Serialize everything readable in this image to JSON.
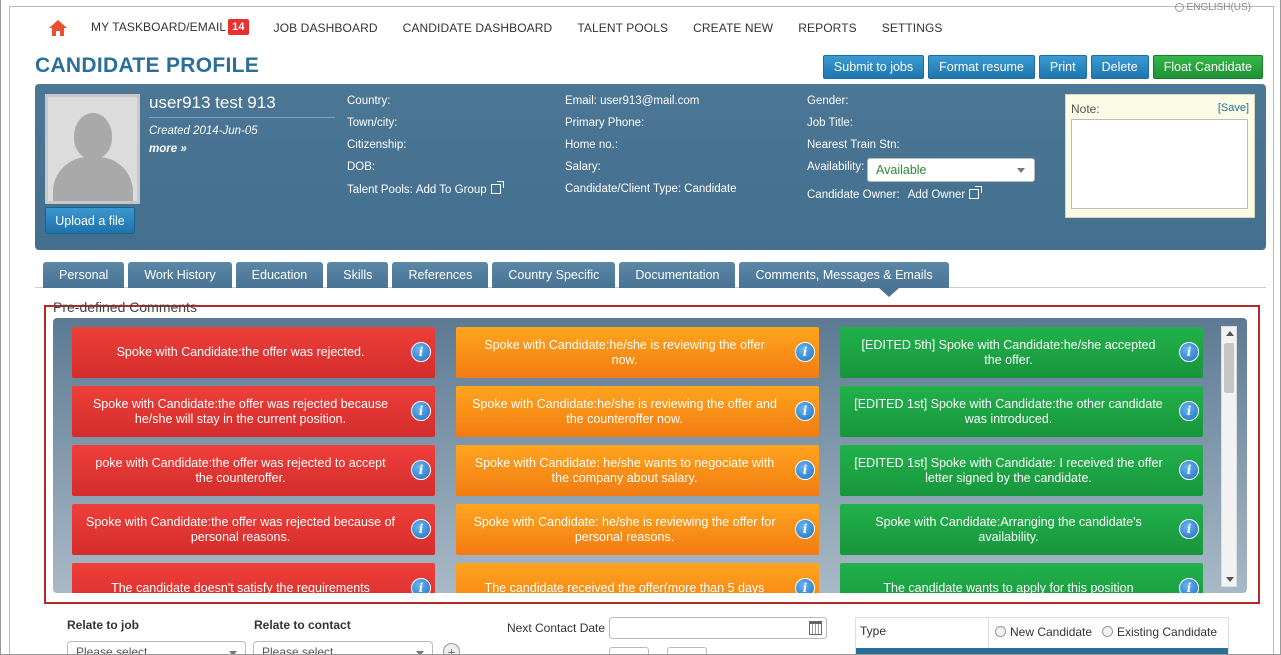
{
  "language": "ENGLISH(US)",
  "nav": {
    "items": [
      {
        "label": "MY TASKBOARD/EMAIL",
        "badge": "14"
      },
      {
        "label": "JOB DASHBOARD"
      },
      {
        "label": "CANDIDATE DASHBOARD"
      },
      {
        "label": "TALENT POOLS"
      },
      {
        "label": "CREATE NEW"
      },
      {
        "label": "REPORTS"
      },
      {
        "label": "SETTINGS"
      }
    ]
  },
  "header": {
    "title": "CANDIDATE PROFILE",
    "actions": [
      "Submit to jobs",
      "Format resume",
      "Print",
      "Delete",
      "Float Candidate"
    ]
  },
  "profile": {
    "name": "user913 test 913",
    "created": "Created 2014-Jun-05",
    "more": "more »",
    "upload": "Upload a file",
    "col1": {
      "country": "Country:",
      "town": "Town/city:",
      "citizenship": "Citizenship:",
      "dob": "DOB:",
      "talent_pools_label": "Talent Pools:",
      "talent_pools_link": "Add To Group"
    },
    "col2": {
      "email": "Email: user913@mail.com",
      "primary_phone": "Primary Phone:",
      "home_no": "Home no.:",
      "salary": "Salary:",
      "type_label": "Candidate/Client Type:",
      "type_value": "Candidate"
    },
    "col3": {
      "gender": "Gender:",
      "job_title": "Job Title:",
      "nearest_train": "Nearest Train Stn:",
      "availability_label": "Availability:",
      "availability_value": "Available",
      "owner_label": "Candidate Owner:",
      "owner_link": "Add Owner"
    },
    "note": {
      "label": "Note:",
      "save": "[Save]"
    }
  },
  "tabs": [
    "Personal",
    "Work History",
    "Education",
    "Skills",
    "References",
    "Country Specific",
    "Documentation",
    "Comments, Messages & Emails"
  ],
  "predefined": {
    "label": "Pre-defined Comments",
    "red": [
      "Spoke with Candidate:the offer was rejected.",
      "Spoke with Candidate:the offer was rejected because he/she will stay in the current position.",
      "poke with Candidate:the offer was rejected to accept the counteroffer.",
      "Spoke with Candidate:the offer was rejected because of personal reasons.",
      "The candidate doesn't satisfy the requirements"
    ],
    "orange": [
      "Spoke with Candidate:he/she is reviewing the offer now.",
      "Spoke with Candidate:he/she is reviewing the offer and the counteroffer now.",
      "Spoke with Candidate: he/she wants to negociate with the company about salary.",
      "Spoke with Candidate: he/she is reviewing the offer for personal reasons.",
      "The candidate received the offer(more than 5 days"
    ],
    "green": [
      "[EDITED 5th] Spoke with Candidate:he/she accepted the offer.",
      "[EDITED 1st] Spoke with Candidate:the other candidate was introduced.",
      "[EDITED 1st] Spoke with Candidate: I received the offer letter signed by the candidate.",
      "Spoke with Candidate:Arranging the candidate's availability.",
      "The candidate wants to apply for this position"
    ]
  },
  "bottom": {
    "relate_job": "Relate to job",
    "relate_contact": "Relate to contact",
    "please_select": "Please select",
    "next_contact": "Next Contact Date",
    "type": "Type",
    "new_candidate": "New Candidate",
    "existing_candidate": "Existing Candidate"
  }
}
